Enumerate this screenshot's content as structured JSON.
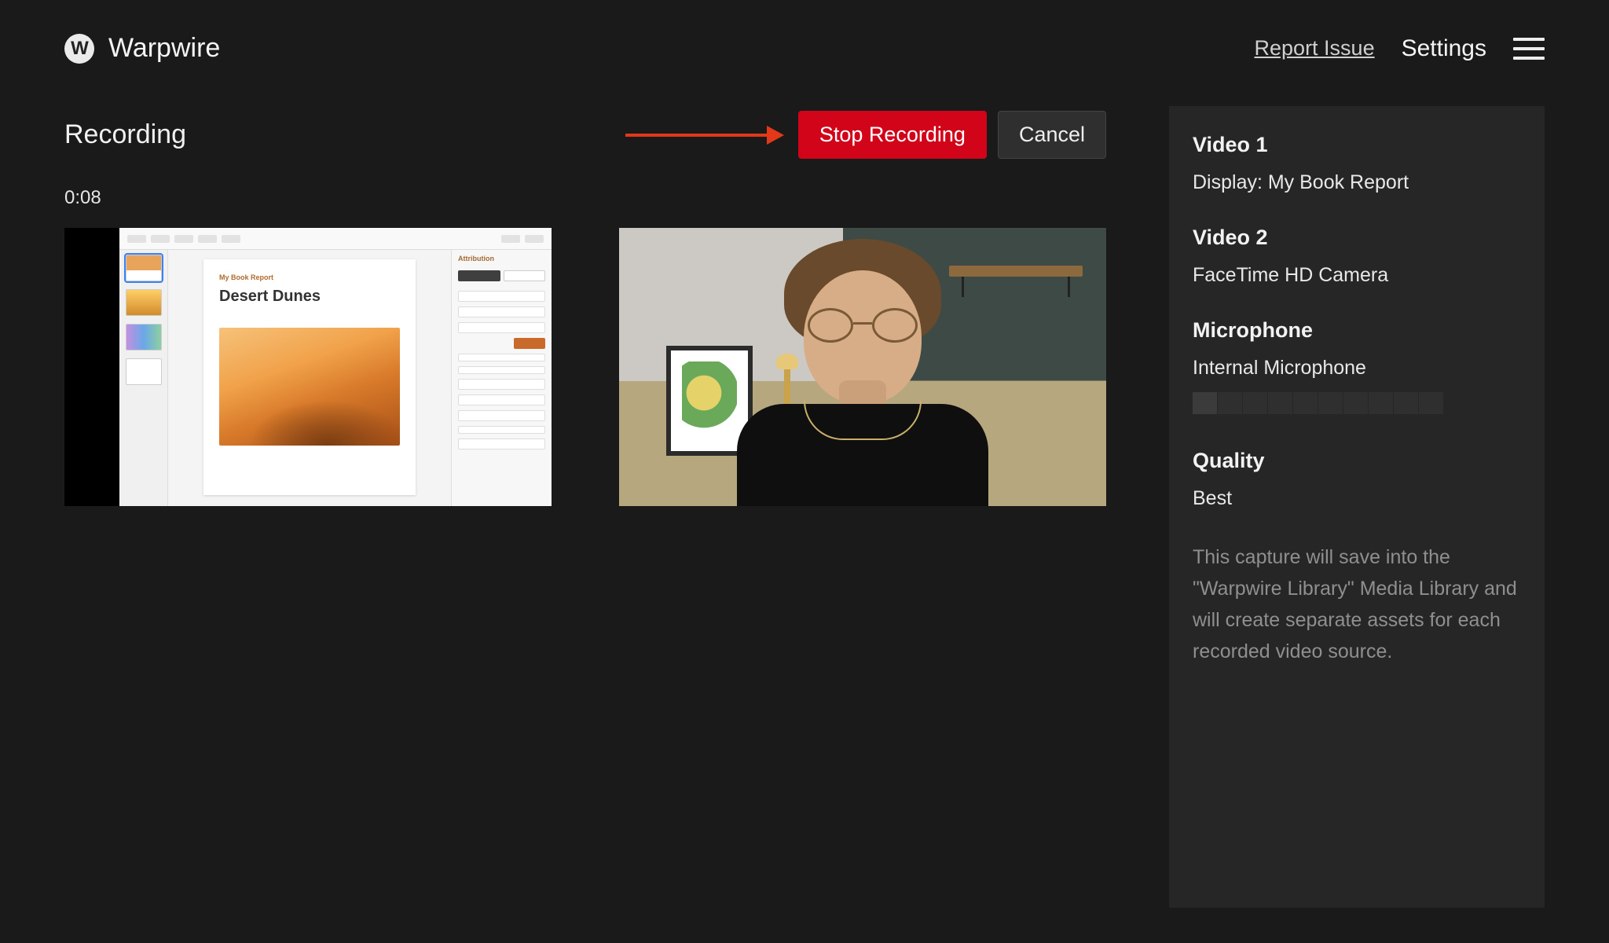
{
  "brand": {
    "name": "Warpwire",
    "logo_letter": "W"
  },
  "header": {
    "report_issue": "Report Issue",
    "settings": "Settings"
  },
  "page": {
    "title": "Recording",
    "timer": "0:08"
  },
  "actions": {
    "stop": "Stop Recording",
    "cancel": "Cancel"
  },
  "preview1": {
    "doc_eyebrow": "My Book Report",
    "doc_title": "Desert Dunes",
    "inspector_title": "Attribution"
  },
  "sidebar": {
    "video1_label": "Video 1",
    "video1_value": "Display: My Book Report",
    "video2_label": "Video 2",
    "video2_value": "FaceTime HD Camera",
    "mic_label": "Microphone",
    "mic_value": "Internal Microphone",
    "mic_level": 1,
    "quality_label": "Quality",
    "quality_value": "Best",
    "note": "This capture will save into the \"Warpwire Library\" Media Library and will create separate assets for each recorded video source."
  }
}
